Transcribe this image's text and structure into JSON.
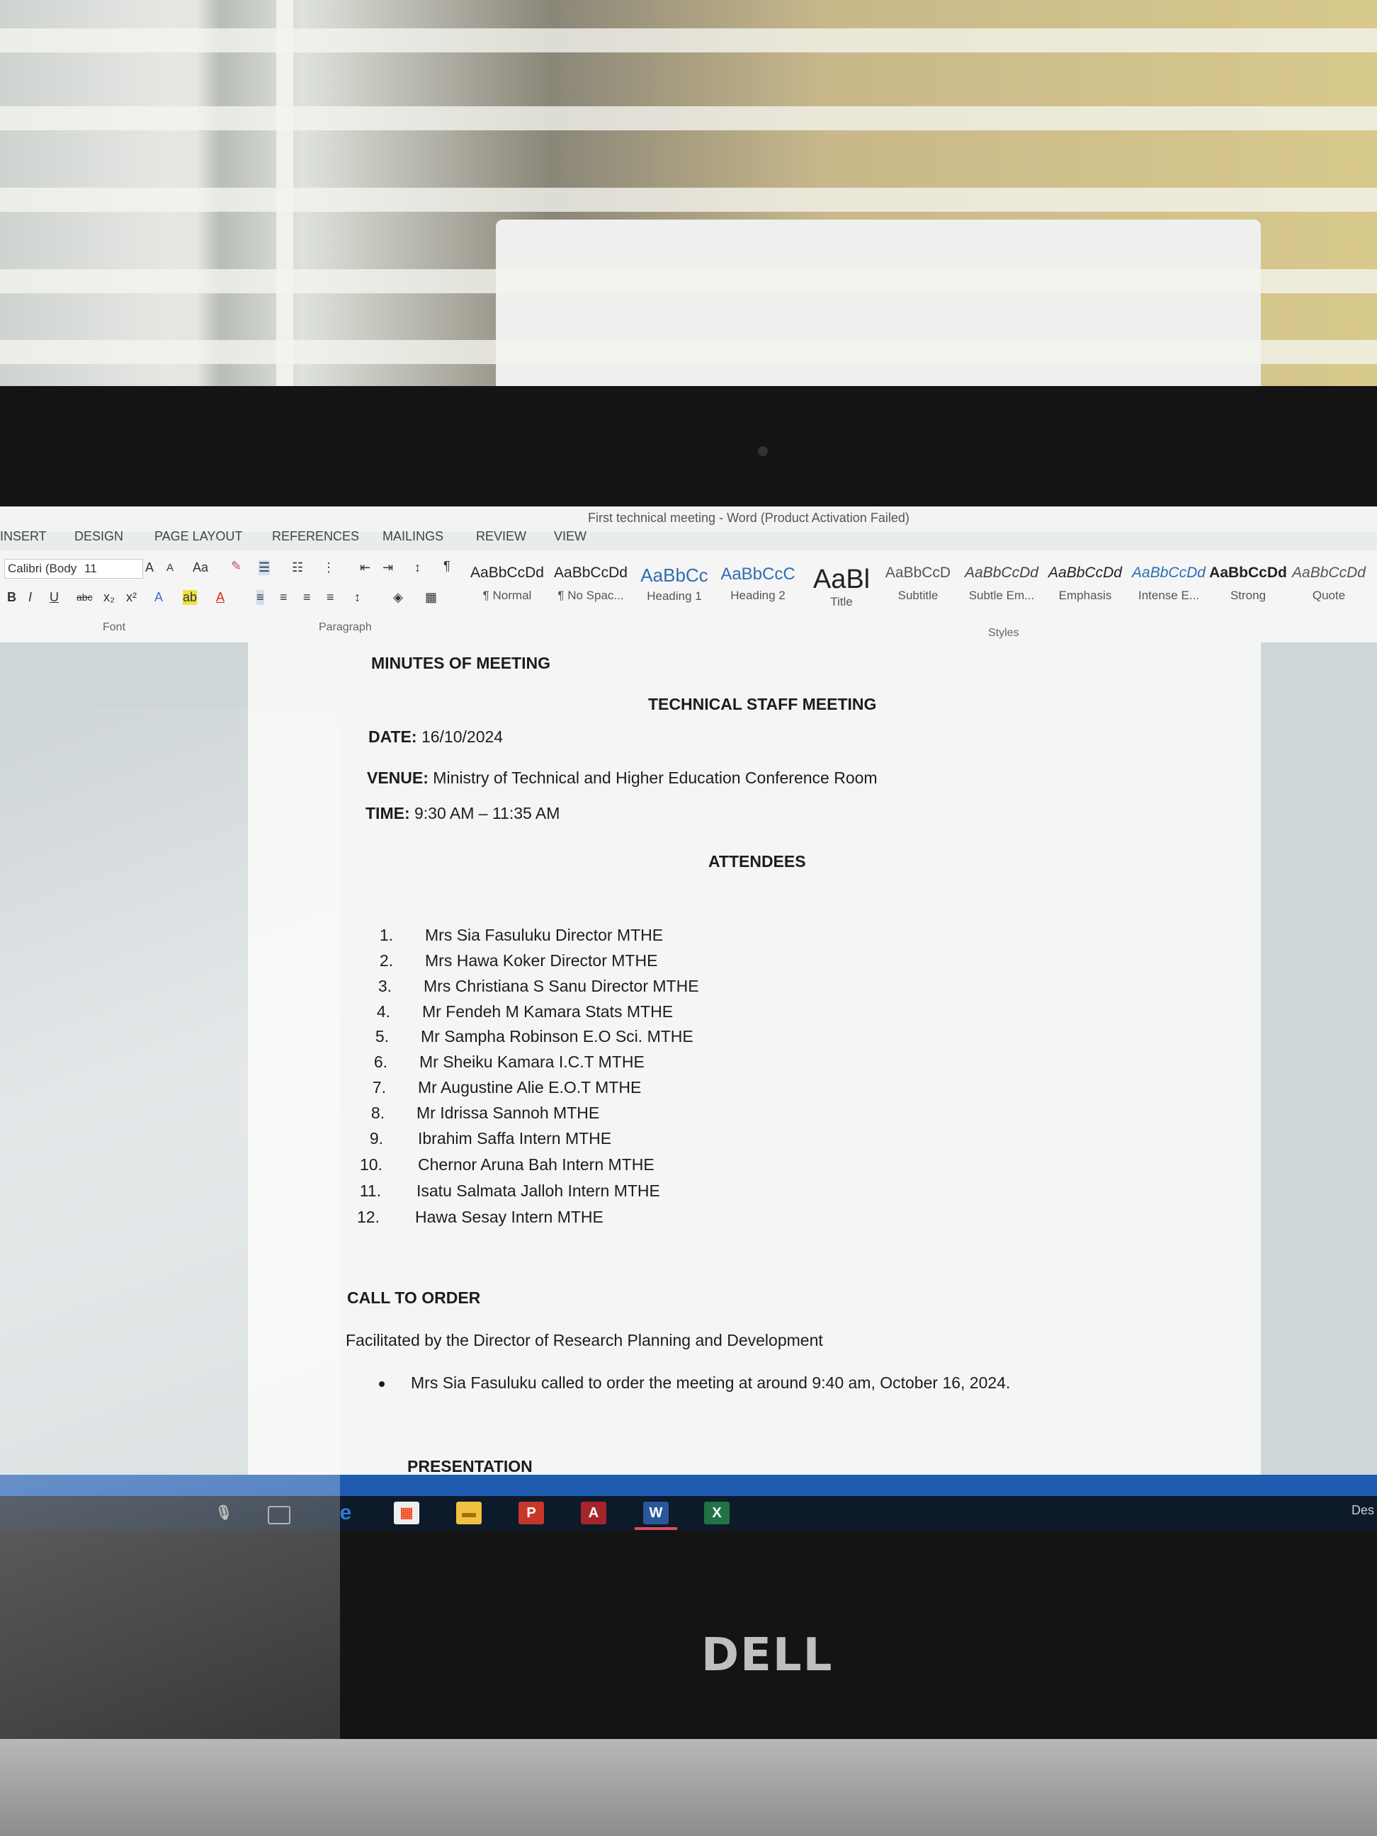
{
  "window": {
    "title": "First technical meeting - Word (Product Activation Failed)"
  },
  "menu": {
    "tabs": [
      "INSERT",
      "DESIGN",
      "PAGE LAYOUT",
      "REFERENCES",
      "MAILINGS",
      "REVIEW",
      "VIEW"
    ]
  },
  "ribbon": {
    "font_name": "Calibri (Body",
    "font_size": "11",
    "group_font": "Font",
    "group_paragraph": "Paragraph",
    "group_styles": "Styles",
    "styles": [
      {
        "sample": "AaBbCcDd",
        "name": "¶ Normal"
      },
      {
        "sample": "AaBbCcDd",
        "name": "¶ No Spac..."
      },
      {
        "sample": "AaBbCc",
        "name": "Heading 1"
      },
      {
        "sample": "AaBbCcC",
        "name": "Heading 2"
      },
      {
        "sample": "AaBl",
        "name": "Title"
      },
      {
        "sample": "AaBbCcD",
        "name": "Subtitle"
      },
      {
        "sample": "AaBbCcDd",
        "name": "Subtle Em..."
      },
      {
        "sample": "AaBbCcDd",
        "name": "Emphasis"
      },
      {
        "sample": "AaBbCcDd",
        "name": "Intense E..."
      },
      {
        "sample": "AaBbCcDd",
        "name": "Strong"
      },
      {
        "sample": "AaBbCcDd",
        "name": "Quote"
      }
    ]
  },
  "document": {
    "heading": "MINUTES OF MEETING",
    "subheading": "TECHNICAL STAFF MEETING",
    "date_label": "DATE:",
    "date_value": "16/10/2024",
    "venue_label": "VENUE:",
    "venue_value": "Ministry of Technical and Higher Education Conference Room",
    "time_label": "TIME:",
    "time_value": "9:30 AM – 11:35 AM",
    "attendees_heading": "ATTENDEES",
    "attendees": [
      {
        "num": "1.",
        "name": "Mrs Sia Fasuluku Director MTHE"
      },
      {
        "num": "2.",
        "name": "Mrs Hawa Koker Director MTHE"
      },
      {
        "num": "3.",
        "name": "Mrs Christiana S Sanu Director MTHE"
      },
      {
        "num": "4.",
        "name": "Mr Fendeh M Kamara Stats MTHE"
      },
      {
        "num": "5.",
        "name": "Mr Sampha Robinson E.O Sci. MTHE"
      },
      {
        "num": "6.",
        "name": "Mr Sheiku Kamara I.C.T MTHE"
      },
      {
        "num": "7.",
        "name": "Mr Augustine Alie E.O.T MTHE"
      },
      {
        "num": "8.",
        "name": "Mr Idrissa Sannoh MTHE"
      },
      {
        "num": "9.",
        "name": "Ibrahim Saffa Intern MTHE"
      },
      {
        "num": "10.",
        "name": "Chernor Aruna Bah Intern MTHE"
      },
      {
        "num": "11.",
        "name": "Isatu Salmata Jalloh Intern MTHE"
      },
      {
        "num": "12.",
        "name": "Hawa Sesay Intern MTHE"
      }
    ],
    "call_to_order_heading": "CALL TO ORDER",
    "facilitated": "Facilitated by the Director of Research Planning and Development",
    "bullet": "Mrs Sia Fasuluku called to order the meeting at around 9:40 am, October 16, 2024.",
    "presentation_heading": "PRESENTATION"
  },
  "taskbar": {
    "icons": [
      "microphone-icon",
      "task-view-icon",
      "edge-icon",
      "store-icon",
      "file-explorer-icon",
      "powerpoint-icon",
      "access-icon",
      "word-icon",
      "excel-icon"
    ],
    "desktop_label": "Des"
  },
  "brand": "DELL"
}
